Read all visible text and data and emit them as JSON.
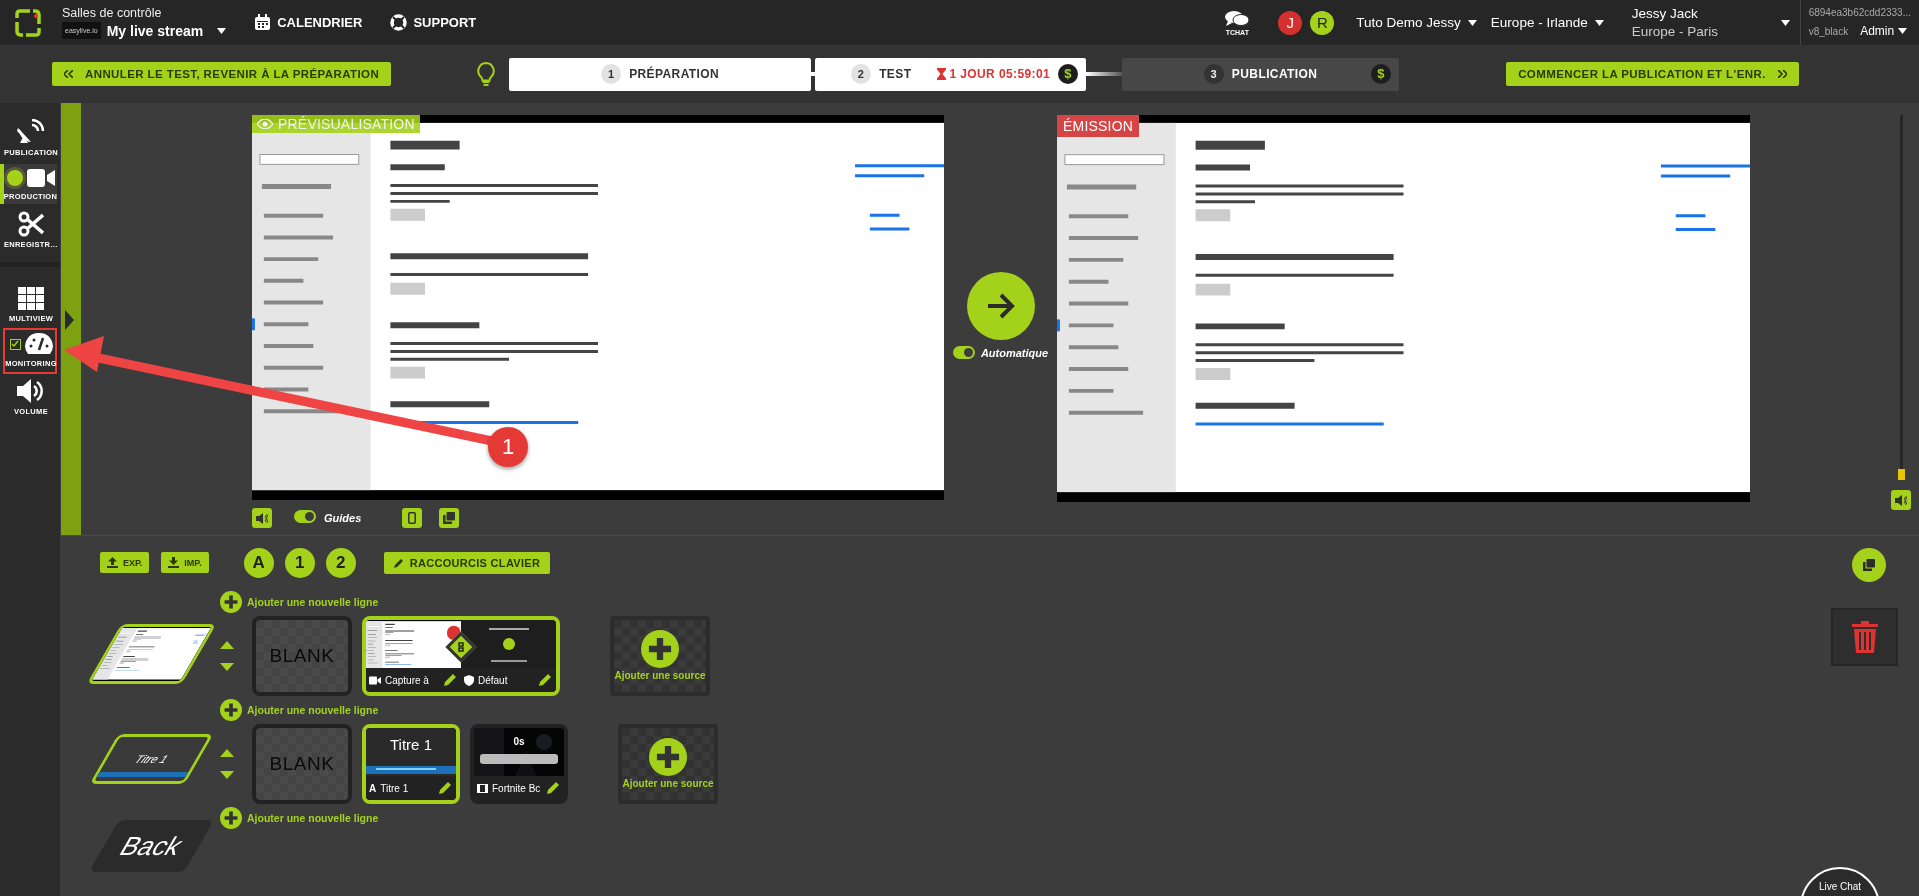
{
  "header": {
    "section": "Salles de contrôle",
    "brand": "easylive.io",
    "stream": "My live stream",
    "nav": [
      {
        "label": "CALENDRIER"
      },
      {
        "label": "SUPPORT"
      }
    ],
    "chat": "TCHAT",
    "avatars": [
      {
        "letter": "J",
        "color": "#d3302f"
      },
      {
        "letter": "R",
        "color": "#a4d21a"
      }
    ],
    "menus": [
      {
        "label": "Tuto Demo Jessy"
      },
      {
        "label": "Europe - Irlande"
      }
    ],
    "user": {
      "name": "Jessy Jack",
      "region": "Europe - Paris"
    },
    "account": {
      "id": "6894ea3b62cdd2333...",
      "version": "v8_black",
      "role": "Admin"
    }
  },
  "workflow": {
    "back": "ANNULER LE TEST, REVENIR À LA PRÉPARATION",
    "steps": [
      {
        "number": "1",
        "label": "PRÉPARATION",
        "reached": true
      },
      {
        "number": "2",
        "label": "TEST",
        "reached": true,
        "timer": "1 JOUR 05:59:01",
        "currency": "$"
      },
      {
        "number": "3",
        "label": "PUBLICATION",
        "reached": false,
        "currency": "$"
      }
    ],
    "next": "COMMENCER LA PUBLICATION ET L'ENR."
  },
  "sidebar": {
    "groups": [
      [
        {
          "label": "PUBLICATION",
          "kind": "plain",
          "selected": false,
          "highlighted": false
        },
        {
          "label": "PRODUCTION",
          "kind": "live",
          "selected": true,
          "highlighted": false
        },
        {
          "label": "ENREGISTR…",
          "kind": "plain",
          "selected": false,
          "highlighted": false
        }
      ],
      [
        {
          "label": "MULTIVIEW",
          "kind": "plain",
          "selected": false,
          "highlighted": false
        },
        {
          "label": "MONITORING",
          "kind": "check",
          "checked": true,
          "selected": false,
          "highlighted": true
        },
        {
          "label": "VOLUME",
          "kind": "plain",
          "selected": false,
          "highlighted": false
        }
      ]
    ]
  },
  "stage": {
    "preview": {
      "label": "PRÉVISUALISATION",
      "kind": "picture"
    },
    "tools": {
      "guides": "Guides",
      "guides_on": true
    },
    "auto": {
      "label": "Automatique",
      "on": true
    },
    "program": {
      "label": "ÉMISSION",
      "kind": "picture"
    },
    "volume": {
      "level": 0.03
    }
  },
  "scenes": {
    "export": "EXP.",
    "import": "IMP.",
    "layouts": [
      {
        "label": "A"
      },
      {
        "label": "1"
      },
      {
        "label": "2"
      }
    ],
    "shortcuts": "RACCOURCIS CLAVIER",
    "add_line": [
      "Ajouter une nouvelle ligne",
      "Ajouter une nouvelle ligne",
      "Ajouter une nouvelle ligne"
    ],
    "layers": [
      {
        "kind": "picture"
      },
      {
        "kind": "title",
        "label": "Titre 1"
      },
      {
        "kind": "back",
        "label": "Back"
      }
    ],
    "rows": [
      {
        "sources": [
          {
            "kind": "blank",
            "label": "BLANK",
            "selected": false
          },
          {
            "kind": "linked",
            "selected": true,
            "parts": [
              {
                "kind": "capture",
                "name": "Capture à"
              },
              {
                "kind": "default",
                "name": "Défaut"
              }
            ]
          }
        ],
        "add_source": "Ajouter une source"
      },
      {
        "sources": [
          {
            "kind": "blank",
            "label": "BLANK",
            "selected": false
          },
          {
            "kind": "title",
            "selected": true,
            "preview": "Titre 1",
            "glyph": "A",
            "name": "Titre 1"
          },
          {
            "kind": "video",
            "selected": false,
            "timer": "0s",
            "name": "Fortnite Bc"
          }
        ],
        "add_source": "Ajouter une source"
      }
    ]
  },
  "live_chat": "Live Chat",
  "annotation": {
    "badge": "1"
  }
}
